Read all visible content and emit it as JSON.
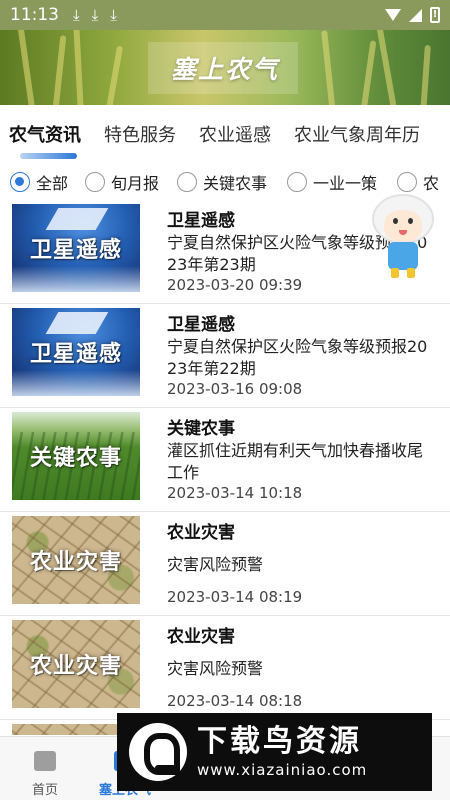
{
  "status_bar": {
    "time": "11:13",
    "download_icons": [
      "download-icon",
      "download-icon",
      "download-icon"
    ],
    "battery_label": "!"
  },
  "banner": {
    "title": "塞上农气"
  },
  "tabs": [
    {
      "label": "农气资讯",
      "active": true
    },
    {
      "label": "特色服务",
      "active": false
    },
    {
      "label": "农业遥感",
      "active": false
    },
    {
      "label": "农业气象周年历",
      "active": false
    }
  ],
  "filters": [
    {
      "label": "全部",
      "selected": true
    },
    {
      "label": "旬月报",
      "selected": false
    },
    {
      "label": "关键农事",
      "selected": false
    },
    {
      "label": "一业一策",
      "selected": false
    },
    {
      "label": "农",
      "selected": false
    }
  ],
  "items": [
    {
      "thumb_label": "卫星遥感",
      "thumb_type": "sat",
      "title": "卫星遥感",
      "desc": "宁夏自然保护区火险气象等级预报2023年第23期",
      "time": "2023-03-20 09:39"
    },
    {
      "thumb_label": "卫星遥感",
      "thumb_type": "sat",
      "title": "卫星遥感",
      "desc": "宁夏自然保护区火险气象等级预报2023年第22期",
      "time": "2023-03-16 09:08"
    },
    {
      "thumb_label": "关键农事",
      "thumb_type": "farm",
      "title": "关键农事",
      "desc": "灌区抓住近期有利天气加快春播收尾工作",
      "time": "2023-03-14 10:18"
    },
    {
      "thumb_label": "农业灾害",
      "thumb_type": "dry",
      "title": "农业灾害",
      "desc": "灾害风险预警",
      "time": "2023-03-14 08:19"
    },
    {
      "thumb_label": "农业灾害",
      "thumb_type": "dry",
      "title": "农业灾害",
      "desc": "灾害风险预警",
      "time": "2023-03-14 08:18"
    }
  ],
  "bottom_nav": [
    {
      "label": "首页",
      "icon": "home-icon",
      "active": false
    },
    {
      "label": "塞上农气",
      "icon": "leaf-icon",
      "active": true
    }
  ],
  "watermark": {
    "name": "下载鸟资源",
    "url": "www.xiazainiao.com"
  },
  "colors": {
    "accent": "#2a78d8",
    "status_bar": "#8a9a5c"
  }
}
